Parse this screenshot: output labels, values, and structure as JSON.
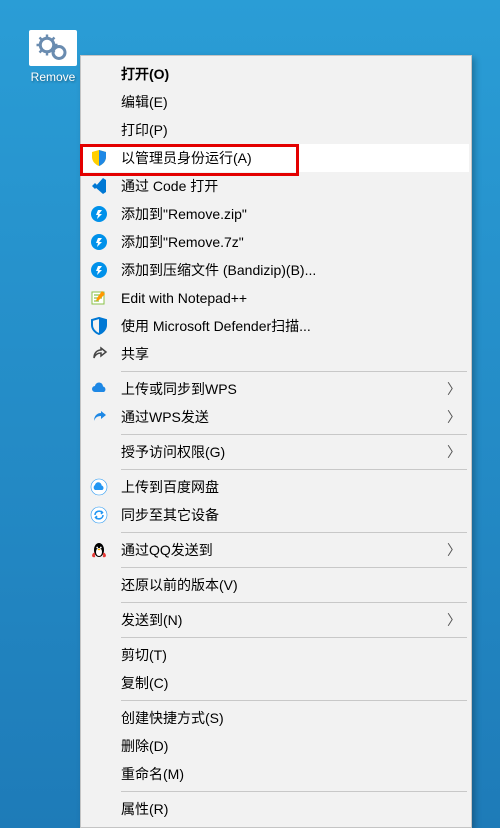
{
  "desktop": {
    "file_label": "Remove"
  },
  "menu": {
    "open": "打开(O)",
    "edit": "编辑(E)",
    "print": "打印(P)",
    "run_as_admin": "以管理员身份运行(A)",
    "open_with_code": "通过 Code 打开",
    "add_to_zip": "添加到\"Remove.zip\"",
    "add_to_7z": "添加到\"Remove.7z\"",
    "add_to_archive": "添加到压缩文件 (Bandizip)(B)...",
    "edit_notepadpp": "Edit with Notepad++",
    "defender_scan": "使用 Microsoft Defender扫描...",
    "share": "共享",
    "wps_upload": "上传或同步到WPS",
    "wps_send": "通过WPS发送",
    "grant_access": "授予访问权限(G)",
    "baidu_upload": "上传到百度网盘",
    "sync_devices": "同步至其它设备",
    "qq_send": "通过QQ发送到",
    "restore_versions": "还原以前的版本(V)",
    "send_to": "发送到(N)",
    "cut": "剪切(T)",
    "copy": "复制(C)",
    "shortcut": "创建快捷方式(S)",
    "delete": "删除(D)",
    "rename": "重命名(M)",
    "properties": "属性(R)"
  }
}
